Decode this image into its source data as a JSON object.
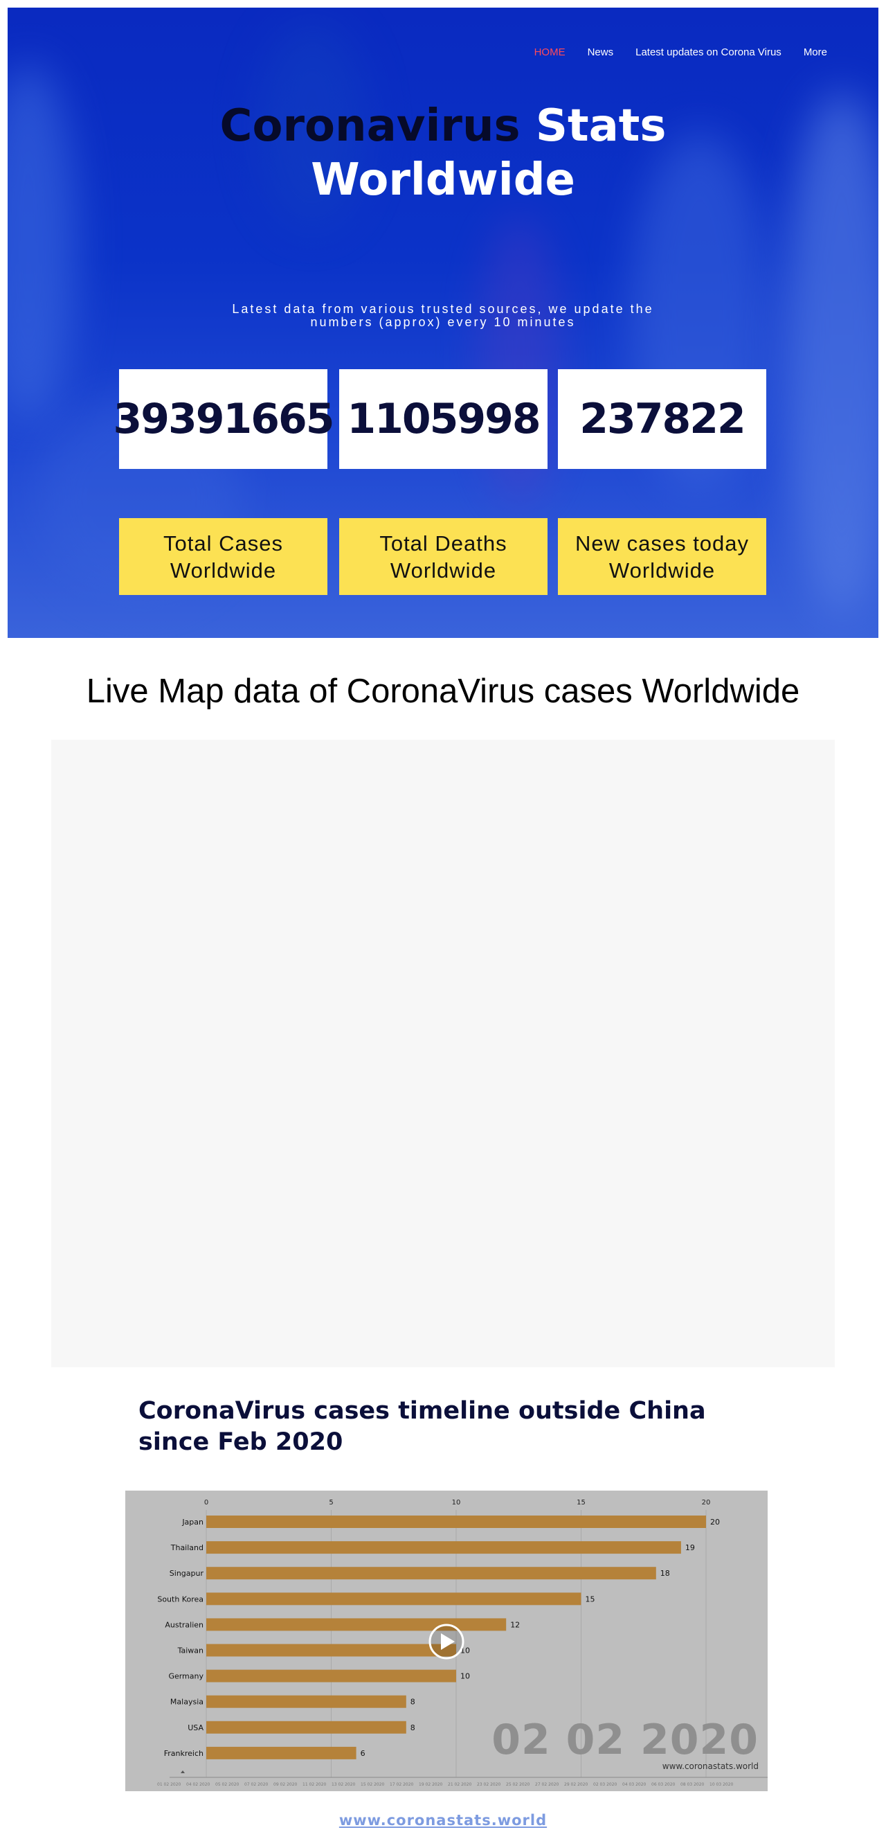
{
  "nav": {
    "items": [
      {
        "label": "HOME",
        "active": true
      },
      {
        "label": "News",
        "active": false
      },
      {
        "label": "Latest updates on Corona Virus",
        "active": false
      },
      {
        "label": "More",
        "active": false
      }
    ]
  },
  "hero": {
    "title_dark": "Coronavirus",
    "title_light_1": "Stats",
    "title_light_2": "Worldwide",
    "subtitle": "Latest data from various trusted sources, we update the numbers (approx) every 10 minutes"
  },
  "stats": [
    {
      "value": "39391665",
      "label_line1": "Total Cases",
      "label_line2": "Worldwide"
    },
    {
      "value": "1105998",
      "label_line1": "Total Deaths",
      "label_line2": "Worldwide"
    },
    {
      "value": "237822",
      "label_line1": "New cases today",
      "label_line2": "Worldwide"
    }
  ],
  "map": {
    "title": "Live Map data of CoronaVirus cases Worldwide"
  },
  "timeline": {
    "title": "CoronaVirus cases timeline outside China since Feb 2020",
    "video_date": "02 02 2020",
    "video_watermark": "www.coronastats.world",
    "play_icon": "play-icon"
  },
  "chart_data": {
    "type": "bar",
    "orientation": "horizontal",
    "categories": [
      "Japan",
      "Thailand",
      "Singapur",
      "South Korea",
      "Australien",
      "Taiwan",
      "Germany",
      "Malaysia",
      "USA",
      "Frankreich"
    ],
    "values": [
      20,
      19,
      18,
      15,
      12,
      10,
      10,
      8,
      8,
      6
    ],
    "xticks": [
      "0",
      "5",
      "10",
      "15",
      "20"
    ],
    "xlim": [
      0,
      22
    ],
    "bar_color": "#b5823a",
    "grid": true
  },
  "footer": {
    "link_text": "www.coronastats.world"
  },
  "colors": {
    "hero_blue": "#0b33c8",
    "accent_yellow": "#fce153",
    "nav_active": "#ff4a5a",
    "navy_text": "#0b0f3a",
    "link_blue": "#7d9be0"
  }
}
